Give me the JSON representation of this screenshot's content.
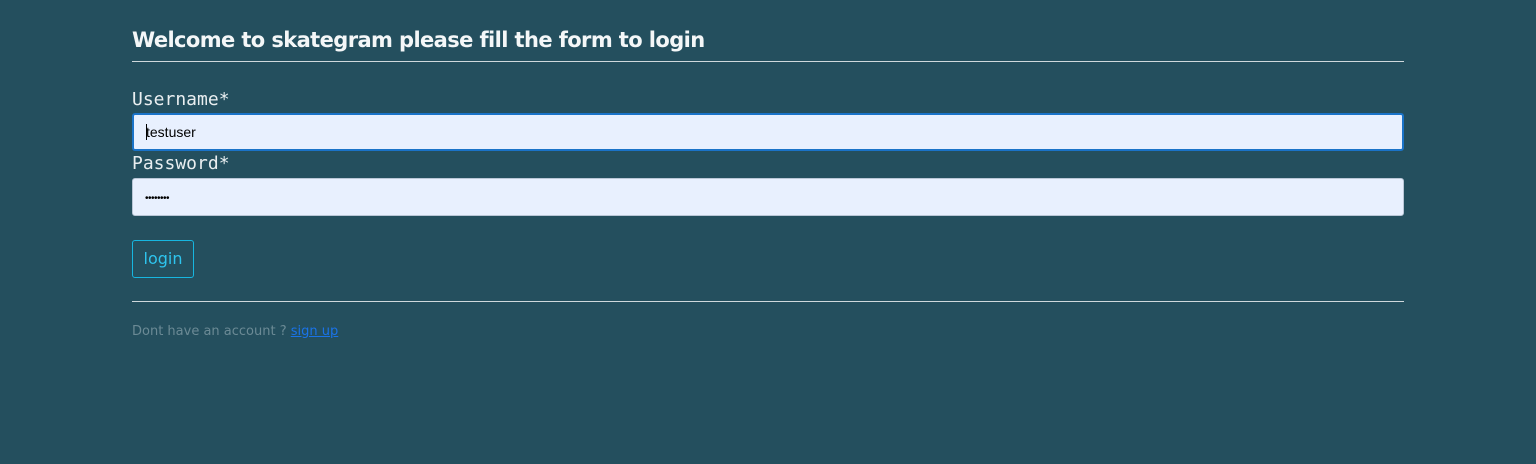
{
  "header": {
    "title": "Welcome to skategram please fill the form to login"
  },
  "form": {
    "username": {
      "label": "Username*",
      "value": "testuser"
    },
    "password": {
      "label": "Password*",
      "masked_value": "••••••••"
    },
    "login_label": "login"
  },
  "footer": {
    "prompt": "Dont have an account ? ",
    "signup_label": "sign up"
  },
  "colors": {
    "background": "#244f5e",
    "input_bg": "#e8f0fe",
    "button_accent": "#17b6e0",
    "link": "#1a73e8",
    "muted_text": "#6b8a95"
  }
}
